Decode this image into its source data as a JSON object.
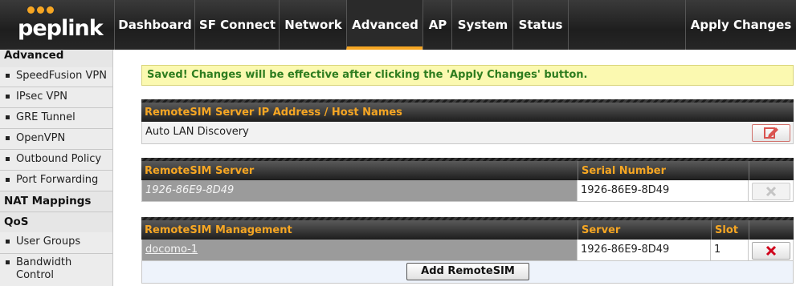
{
  "brand": {
    "logo_text": "peplink",
    "accent": "#f6a623"
  },
  "nav": {
    "tabs": [
      {
        "label": "Dashboard"
      },
      {
        "label": "SF Connect"
      },
      {
        "label": "Network"
      },
      {
        "label": "Advanced"
      },
      {
        "label": "AP"
      },
      {
        "label": "System"
      },
      {
        "label": "Status"
      }
    ],
    "active": "Advanced",
    "apply_label": "Apply Changes"
  },
  "sidebar": {
    "section_advanced": "Advanced",
    "items_advanced": [
      {
        "label": "SpeedFusion VPN"
      },
      {
        "label": "IPsec VPN"
      },
      {
        "label": "GRE Tunnel"
      },
      {
        "label": "OpenVPN"
      },
      {
        "label": "Outbound Policy"
      },
      {
        "label": "Port Forwarding"
      }
    ],
    "section_nat": "NAT Mappings",
    "section_qos": "QoS",
    "items_qos": [
      {
        "label": "User Groups"
      },
      {
        "label": "Bandwidth Control"
      }
    ]
  },
  "notice": {
    "text": "Saved! Changes will be effective after clicking the 'Apply Changes' button."
  },
  "server_ip": {
    "header": "RemoteSIM Server IP Address / Host Names",
    "value": "Auto LAN Discovery",
    "edit_icon": "edit-icon"
  },
  "server_table": {
    "col_server": "RemoteSIM Server",
    "col_serial": "Serial Number",
    "rows": [
      {
        "server": "1926-86E9-8D49",
        "serial": "1926-86E9-8D49"
      }
    ]
  },
  "management_table": {
    "col_management": "RemoteSIM Management",
    "col_server": "Server",
    "col_slot": "Slot",
    "rows": [
      {
        "name": "docomo-1",
        "server": "1926-86E9-8D49",
        "slot": "1"
      }
    ],
    "add_label": "Add RemoteSIM"
  }
}
